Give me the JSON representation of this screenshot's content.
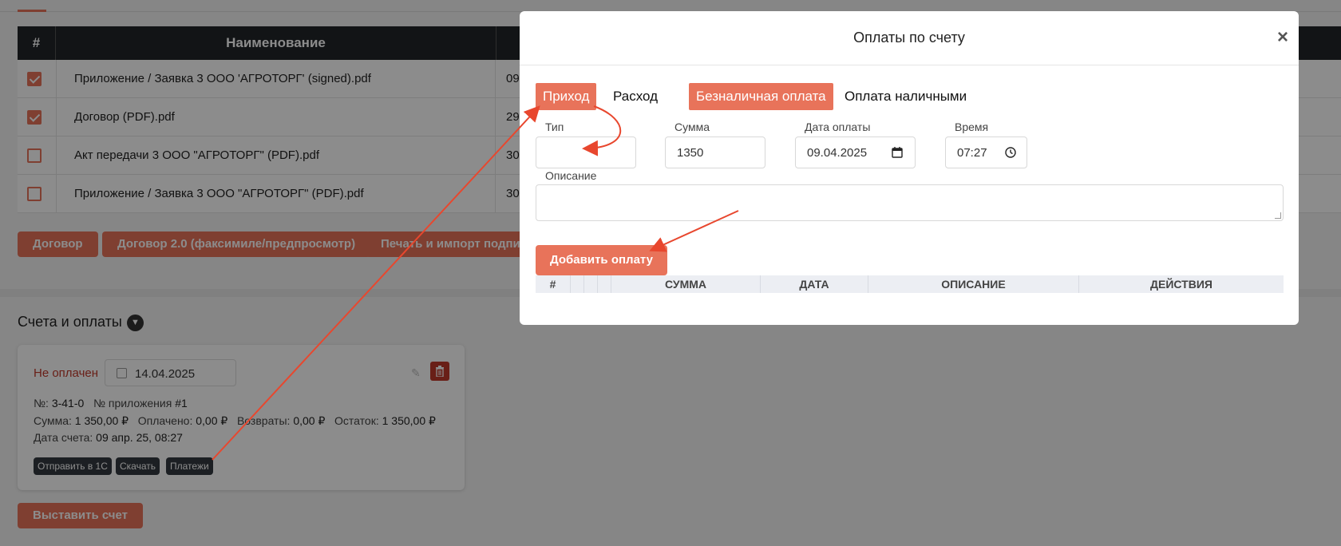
{
  "files_table": {
    "headers": {
      "num": "#",
      "name": "Наименование"
    },
    "rows": [
      {
        "checked": true,
        "name": "Приложение / Заявка 3 ООО 'АГРОТОРГ' (signed).pdf",
        "date": "09"
      },
      {
        "checked": true,
        "name": "Договор (PDF).pdf",
        "date": "29"
      },
      {
        "checked": false,
        "name": "Акт передачи 3 ООО \"АГРОТОРГ\" (PDF).pdf",
        "date": "30"
      },
      {
        "checked": false,
        "name": "Приложение / Заявка 3 ООО \"АГРОТОРГ\" (PDF).pdf",
        "date": "30"
      }
    ]
  },
  "doc_buttons": {
    "contract": "Договор",
    "contract2": "Договор 2.0 (факсимиле/предпросмотр)",
    "print_import": "Печать и импорт подпис"
  },
  "accounts": {
    "title": "Счета и оплаты",
    "invoice": {
      "status": "Не оплачен",
      "date": "14.04.2025",
      "number_label": "№:",
      "number": "3-41-0",
      "app_label": "№ приложения",
      "app": "#1",
      "sum_label": "Сумма:",
      "sum": "1 350,00 ₽",
      "paid_label": "Оплачено:",
      "paid": "0,00 ₽",
      "refunds_label": "Возвраты:",
      "refunds": "0,00 ₽",
      "rest_label": "Остаток:",
      "rest": "1 350,00 ₽",
      "invoice_date_label": "Дата счета:",
      "invoice_date": "09 апр. 25, 08:27",
      "tags": [
        "Отправить в 1С",
        "Скачать",
        "Платежи"
      ]
    },
    "issue_button": "Выставить счет"
  },
  "modal": {
    "title": "Оплаты по счету",
    "close": "×",
    "direction_tabs": [
      "Приход",
      "Расход"
    ],
    "method_tabs": [
      "Безналичная оплата",
      "Оплата наличными"
    ],
    "fields": {
      "type_label": "Тип",
      "type_value": "",
      "sum_label": "Сумма",
      "sum_value": "1350",
      "date_label": "Дата оплаты",
      "date_value": "09.04.2025",
      "time_label": "Время",
      "time_value": "07:27",
      "description_label": "Описание"
    },
    "add_button": "Добавить оплату",
    "payments_table": {
      "headers": [
        "#",
        "",
        "",
        "",
        "СУММА",
        "ДАТА",
        "ОПИСАНИЕ",
        "ДЕЙСТВИЯ"
      ]
    }
  },
  "colors": {
    "accent": "#e8735a",
    "danger": "#c0392b",
    "table_header": "#212529",
    "annotation": "#e8472e"
  },
  "icons": [
    "close-icon",
    "calendar-icon",
    "clock-icon",
    "trash-icon",
    "pencil-icon",
    "chevron-down-icon"
  ]
}
